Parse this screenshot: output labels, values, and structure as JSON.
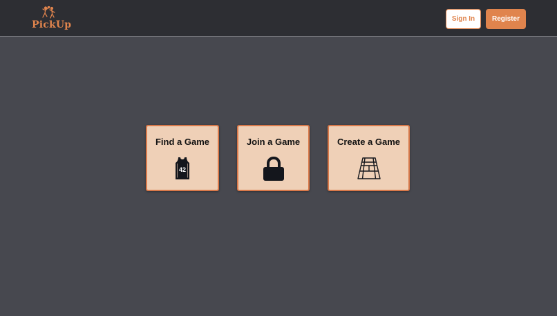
{
  "app": {
    "name": "PickUp",
    "colors": {
      "accent": "#e0844d",
      "header_bg": "#2d2e33",
      "page_bg": "#47484f",
      "card_bg": "#efd0b7",
      "card_border": "#d9794a"
    }
  },
  "header": {
    "logo_icon": "basketball-players-icon",
    "logo_text": "PickUp",
    "sign_in_label": "Sign In",
    "register_label": "Register"
  },
  "cards": [
    {
      "title": "Find a Game",
      "icon": "jersey-icon",
      "jersey_number": "42"
    },
    {
      "title": "Join a Game",
      "icon": "lock-icon"
    },
    {
      "title": "Create a Game",
      "icon": "court-icon"
    }
  ]
}
